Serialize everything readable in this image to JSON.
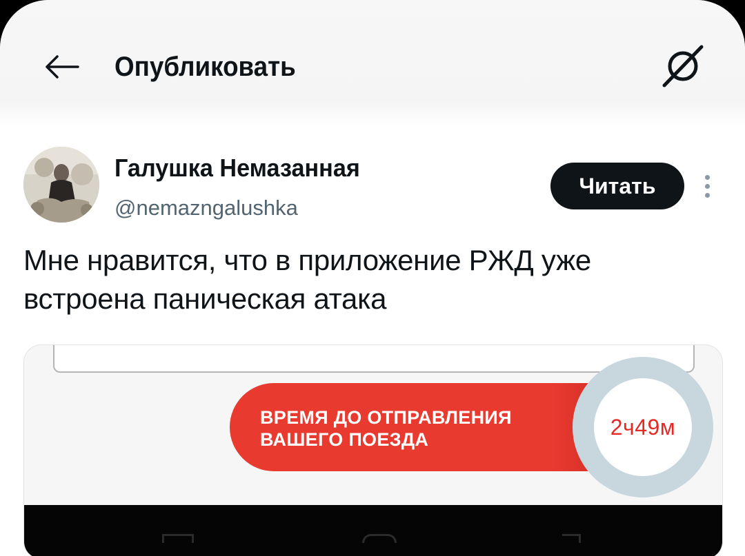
{
  "header": {
    "back_icon": "arrow-left-icon",
    "title": "Опубликовать",
    "grok_icon": "grok-icon"
  },
  "author": {
    "name": "Галушка Немазанная",
    "handle": "@nemazngalushka",
    "follow_label": "Читать",
    "more_icon": "more-vertical-icon"
  },
  "post": {
    "text": "Мне нравится, что в приложение РЖД уже встроена паническая атака"
  },
  "media": {
    "banner_line1": "ВРЕМЯ ДО ОТПРАВЛЕНИЯ",
    "banner_line2": "ВАШЕГО ПОЕЗДА",
    "countdown": "2ч49м",
    "colors": {
      "banner": "#e93a30",
      "countdown_text": "#e32a25",
      "ring": "#c8d7de"
    }
  }
}
